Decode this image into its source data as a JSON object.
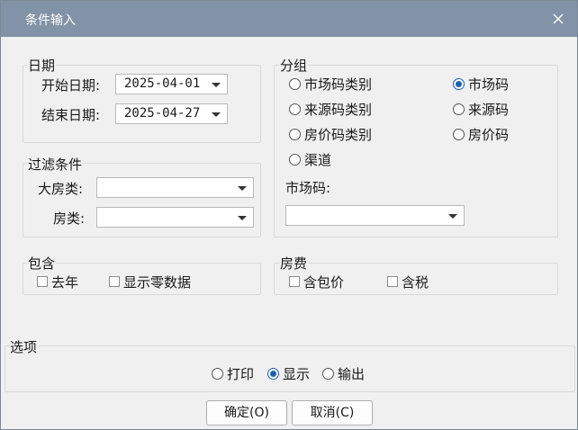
{
  "window": {
    "title": "条件输入"
  },
  "date_group": {
    "legend": "日期",
    "start_label": "开始日期:",
    "start_value": "2025-04-01",
    "end_label": "结束日期:",
    "end_value": "2025-04-27"
  },
  "filter_group": {
    "legend": "过滤条件",
    "big_room_type_label": "大房类:",
    "big_room_type_value": "",
    "room_type_label": "房类:",
    "room_type_value": ""
  },
  "group_by": {
    "legend": "分组",
    "options": [
      {
        "label": "市场码类别",
        "checked": false
      },
      {
        "label": "市场码",
        "checked": true
      },
      {
        "label": "来源码类别",
        "checked": false
      },
      {
        "label": "来源码",
        "checked": false
      },
      {
        "label": "房价码类别",
        "checked": false
      },
      {
        "label": "房价码",
        "checked": false
      },
      {
        "label": "渠道",
        "checked": false
      }
    ],
    "market_code_label": "市场码:",
    "market_code_value": ""
  },
  "include_group": {
    "legend": "包含",
    "last_year_label": "去年",
    "last_year_checked": false,
    "show_zero_label": "显示零数据",
    "show_zero_checked": false
  },
  "fee_group": {
    "legend": "房费",
    "incl_package_label": "含包价",
    "incl_package_checked": false,
    "incl_tax_label": "含税",
    "incl_tax_checked": false
  },
  "options_group": {
    "legend": "选项",
    "outputs": [
      {
        "label": "打印",
        "checked": false
      },
      {
        "label": "显示",
        "checked": true
      },
      {
        "label": "输出",
        "checked": false
      }
    ]
  },
  "buttons": {
    "ok_label": "确定(O)",
    "cancel_label": "取消(C)"
  }
}
